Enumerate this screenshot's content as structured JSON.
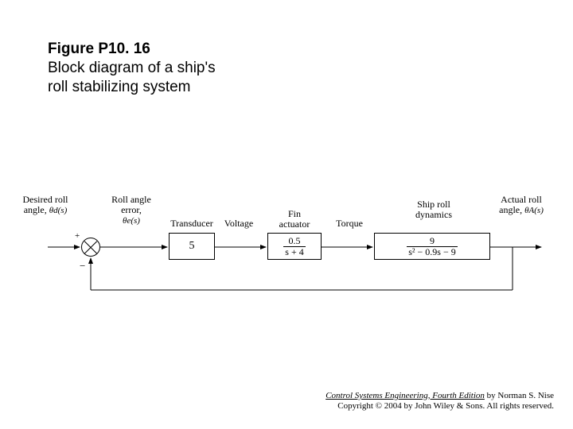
{
  "figure": {
    "number": "Figure P10. 16",
    "description": "Block diagram of a ship's roll stabilizing system"
  },
  "diagram": {
    "input": {
      "label": "Desired roll angle,",
      "symbol": "θd(s)"
    },
    "summing": {
      "plus": "+",
      "minus": "−"
    },
    "error": {
      "label": "Roll angle error,",
      "symbol": "θe(s)"
    },
    "transducer": {
      "label": "Transducer",
      "gain": "5",
      "output_label": "Voltage"
    },
    "actuator": {
      "label": "Fin actuator",
      "tf_num": "0.5",
      "tf_den": "s + 4",
      "output_label": "Torque"
    },
    "ship": {
      "label": "Ship roll dynamics",
      "tf_num": "9",
      "tf_den": "s² − 0.9s − 9"
    },
    "output": {
      "label": "Actual roll angle,",
      "symbol": "θA(s)"
    }
  },
  "attribution": {
    "book": "Control Systems Engineering, Fourth Edition",
    "author": " by Norman S. Nise",
    "copyright": "Copyright © 2004 by John Wiley & Sons. All rights reserved."
  }
}
